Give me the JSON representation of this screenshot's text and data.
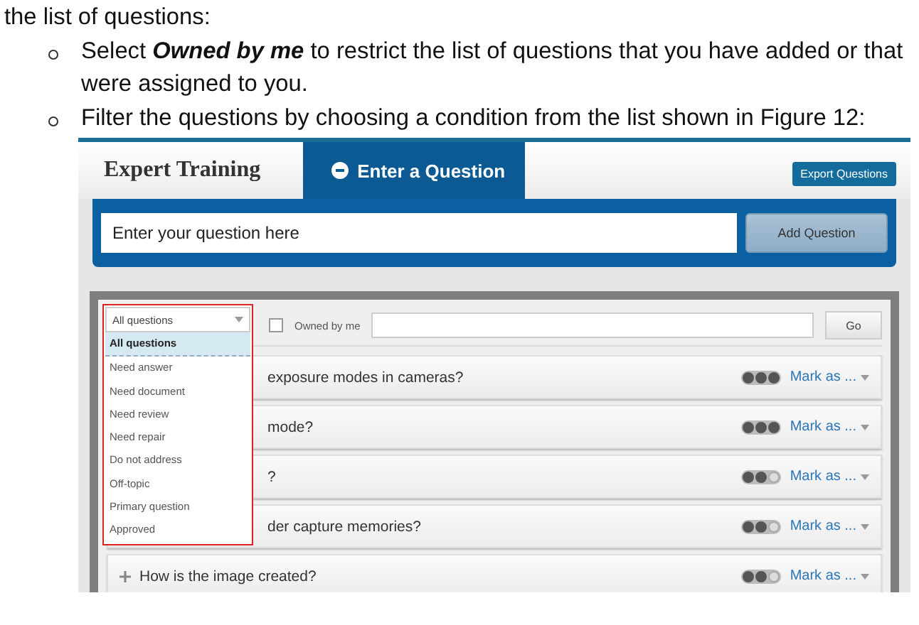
{
  "intro": "the list of questions:",
  "bullets": [
    "Select **Owned by me** to restrict the list of questions that you have added or that were assigned to you.",
    "Filter the questions by choosing a condition from the list shown in Figure 12:"
  ],
  "app": {
    "title": "Expert Training",
    "tab": {
      "label": "Enter a Question",
      "selected": true
    },
    "export_button": "Export Questions",
    "question_input": {
      "placeholder": "Enter your question here"
    },
    "add_button": "Add Question",
    "filter": {
      "value": "All questions",
      "options": [
        {
          "label": "All questions",
          "selected": true
        },
        {
          "label": "Need answer",
          "selected": false
        },
        {
          "label": "Need document",
          "selected": false
        },
        {
          "label": "Need review",
          "selected": false
        },
        {
          "label": "Need repair",
          "selected": false
        },
        {
          "label": "Do not address",
          "selected": false
        },
        {
          "label": "Off-topic",
          "selected": false
        },
        {
          "label": "Primary question",
          "selected": false
        },
        {
          "label": "Approved",
          "selected": false
        }
      ],
      "owned_by_me": {
        "label": "Owned by me",
        "checked": false
      },
      "go_button": "Go"
    },
    "questions": [
      {
        "kind": "covered",
        "text": "exposure modes in cameras?",
        "stars": 3,
        "mark": "Mark as ..."
      },
      {
        "kind": "covered",
        "text": "mode?",
        "stars": 3,
        "mark": "Mark as ..."
      },
      {
        "kind": "covered",
        "text": "?",
        "stars": 2,
        "mark": "Mark as ..."
      },
      {
        "kind": "covered",
        "text": "der capture memories?",
        "stars": 2,
        "mark": "Mark as ..."
      },
      {
        "kind": "full",
        "text": "How is the image created?",
        "stars": 2,
        "mark": "Mark as ..."
      }
    ]
  }
}
